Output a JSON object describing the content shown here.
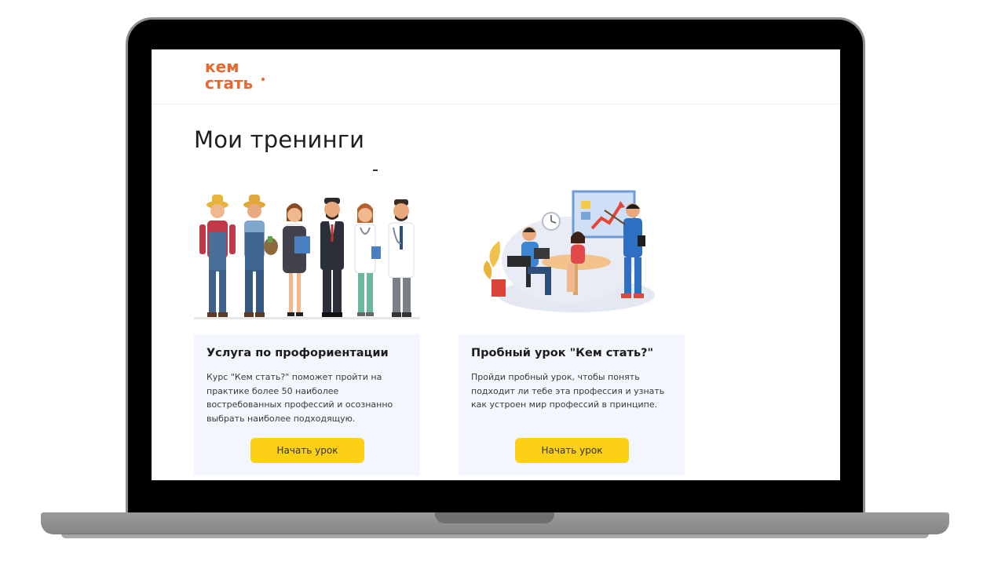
{
  "header": {
    "logo_line1": "кем",
    "logo_line2": "стать",
    "logo_color": "#e8672e"
  },
  "main": {
    "title": "Мои тренинги",
    "cards": [
      {
        "illustration": "professions-group-illustration",
        "title": "Услуга по профориентации",
        "description": "Курс \"Кем стать?\" поможет пройти на практике более 50 наиболее востребованных профессий и осознанно выбрать наиболее подходящую.",
        "button_label": "Начать урок"
      },
      {
        "illustration": "office-meeting-illustration",
        "title": "Пробный урок \"Кем стать?\"",
        "description": "Пройди пробный урок, чтобы понять подходит ли тебе эта профессия и узнать как устроен мир профессий в принципе.",
        "button_label": "Начать урок"
      }
    ]
  },
  "colors": {
    "button": "#fcd015",
    "card_background": "#f3f6fc",
    "device_frame": "#000000"
  }
}
